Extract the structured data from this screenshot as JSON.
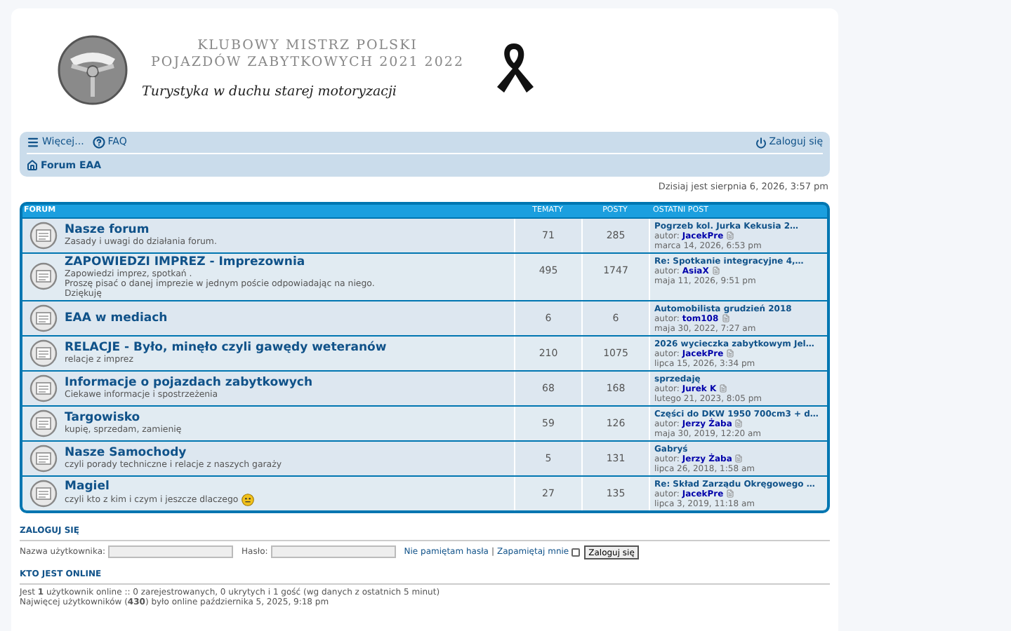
{
  "banner": {
    "title_lines": [
      "KLUBOWY MISTRZ POLSKI",
      "POJAZDÓW ZABYTKOWYCH 2021 2022"
    ],
    "tagline": "Turystyka w duchu starej motoryzacji"
  },
  "nav": {
    "items": [
      {
        "kind": "menu",
        "label": "Więcej..."
      },
      {
        "kind": "help",
        "label": "FAQ"
      }
    ],
    "login": "Zaloguj się",
    "breadcrumb": "Forum EAA"
  },
  "date": "Dzisiaj jest sierpnia 6, 2026, 3:57 pm",
  "forum": {
    "columns": [
      "FORUM",
      "TEMATY",
      "POSTY",
      "OSTATNI POST"
    ],
    "rows": [
      {
        "title": "Nasze forum",
        "description": [
          "Zasady i uwagi do działania forum."
        ],
        "topics": "71",
        "posts": "285",
        "last_post": {
          "title": "Pogrzeb kol. Jurka Kekusia 2…",
          "author_label": "autor:",
          "author": "JacekPre",
          "time": "marca 14, 2026, 6:53 pm"
        }
      },
      {
        "title": "ZAPOWIEDZI IMPREZ - Imprezownia",
        "description": [
          "Zapowiedzi imprez, spotkań .",
          "Proszę pisać o danej imprezie w jednym poście odpowiadając na niego.",
          "Dziękuję"
        ],
        "topics": "495",
        "posts": "1747",
        "last_post": {
          "title": "Re: Spotkanie integracyjne 4,…",
          "author_label": "autor:",
          "author": "AsiaX",
          "time": "maja 11, 2026, 9:51 pm"
        }
      },
      {
        "title": "EAA w mediach",
        "description": [],
        "topics": "6",
        "posts": "6",
        "last_post": {
          "title": "Automobilista grudzień 2018",
          "author_label": "autor:",
          "author": "tom108",
          "time": "maja 30, 2022, 7:27 am"
        }
      },
      {
        "title": "RELACJE - Było, minęło czyli gawędy weteranów",
        "description": [
          "relacje z imprez"
        ],
        "topics": "210",
        "posts": "1075",
        "last_post": {
          "title": "2026 wycieczka zabytkowym Jel…",
          "author_label": "autor:",
          "author": "JacekPre",
          "time": "lipca 15, 2026, 3:34 pm"
        }
      },
      {
        "title": "Informacje o pojazdach zabytkowych",
        "description": [
          "Ciekawe informacje i spostrzeżenia"
        ],
        "topics": "68",
        "posts": "168",
        "last_post": {
          "title": "sprzedaję",
          "author_label": "autor:",
          "author": "Jurek K",
          "time": "lutego 21, 2023, 8:05 pm"
        }
      },
      {
        "title": "Targowisko",
        "description": [
          "kupię, sprzedam, zamienię"
        ],
        "topics": "59",
        "posts": "126",
        "last_post": {
          "title": "Części do DKW 1950 700cm3 + d…",
          "author_label": "autor:",
          "author": "Jerzy Żaba",
          "time": "maja 30, 2019, 12:20 am"
        }
      },
      {
        "title": "Nasze Samochody",
        "description": [
          "czyli porady techniczne i relacje z naszych garaży"
        ],
        "topics": "5",
        "posts": "131",
        "last_post": {
          "title": "Gabryś",
          "author_label": "autor:",
          "author": "Jerzy Żaba",
          "time": "lipca 26, 2018, 1:58 am"
        }
      },
      {
        "title": "Magiel",
        "description": [
          "czyli kto z kim i czym i jeszcze dlaczego"
        ],
        "emoji": true,
        "topics": "27",
        "posts": "135",
        "last_post": {
          "title": "Re: Skład Zarządu Okręgowego …",
          "author_label": "autor:",
          "author": "JacekPre",
          "time": "lipca 3, 2019, 11:18 am"
        }
      }
    ]
  },
  "login": {
    "heading": "ZALOGUJ SIĘ",
    "username_label": "Nazwa użytkownika:",
    "password_label": "Hasło:",
    "forgot": "Nie pamiętam hasła",
    "separator": "|",
    "remember": "Zapamiętaj mnie",
    "remember_checked": false,
    "button": "Zaloguj się"
  },
  "online": {
    "heading": "KTO JEST ONLINE",
    "lines": [
      "Jest **1** użytkownik online :: 0 zarejestrowanych, 0 ukrytych i 1 gość (wg danych z ostatnich 5 minut)",
      "Najwięcej użytkowników (**430**) było online października 5, 2025, 9:18 pm"
    ]
  }
}
